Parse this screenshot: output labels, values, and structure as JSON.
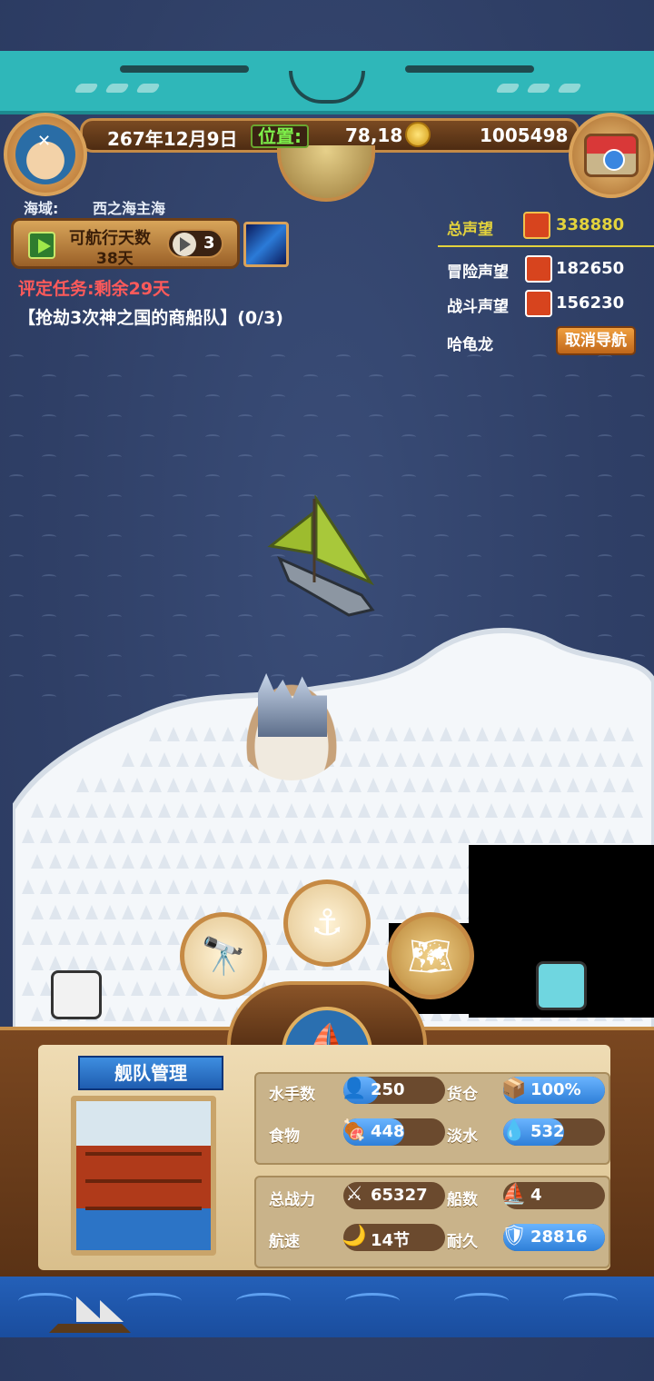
{
  "hud": {
    "date": "267年12月9日",
    "position_label": "位置:",
    "position_value": "78,18",
    "gold": "1005498"
  },
  "sea_zone": {
    "label": "海域:",
    "value": "西之海主海"
  },
  "sailing": {
    "days_label": "可航行天数",
    "days_value": "38天",
    "sail_count": "3"
  },
  "mission": {
    "deadline": "评定任务:剩余29天",
    "objective": "【抢劫3次神之国的商船队】(0/3)"
  },
  "reputation": {
    "total_label": "总声望",
    "total_value": "338880",
    "adventure_label": "冒险声望",
    "adventure_value": "182650",
    "battle_label": "战斗声望",
    "battle_value": "156230",
    "target_name": "哈龟龙",
    "cancel_nav": "取消导航",
    "colors": {
      "total": "#e3d23c",
      "icon_bg": "#d7441e"
    }
  },
  "actions": {
    "telescope_icon": "telescope-icon",
    "anchor_icon": "anchor-icon",
    "map_icon": "map-icon",
    "ship_icon": "ship-icon"
  },
  "fleet": {
    "title": "舰队管理",
    "stats_top": [
      {
        "label": "水手数",
        "value": "250",
        "icon": "sailor-icon",
        "fill": 0.35
      },
      {
        "label": "货仓",
        "value": "100%",
        "icon": "cargo-icon",
        "fill": 1.0
      },
      {
        "label": "食物",
        "value": "448",
        "icon": "food-icon",
        "fill": 0.6
      },
      {
        "label": "淡水",
        "value": "532",
        "icon": "water-icon",
        "fill": 0.6
      }
    ],
    "stats_bottom": [
      {
        "label": "总战力",
        "value": "65327",
        "icon": "sword-icon",
        "fill": 0.0
      },
      {
        "label": "船数",
        "value": "4",
        "icon": "boat-icon",
        "fill": 0.0
      },
      {
        "label": "航速",
        "value": "14节",
        "icon": "speed-icon",
        "fill": 0.0
      },
      {
        "label": "耐久",
        "value": "28816",
        "icon": "durability-icon",
        "fill": 1.0
      }
    ]
  }
}
